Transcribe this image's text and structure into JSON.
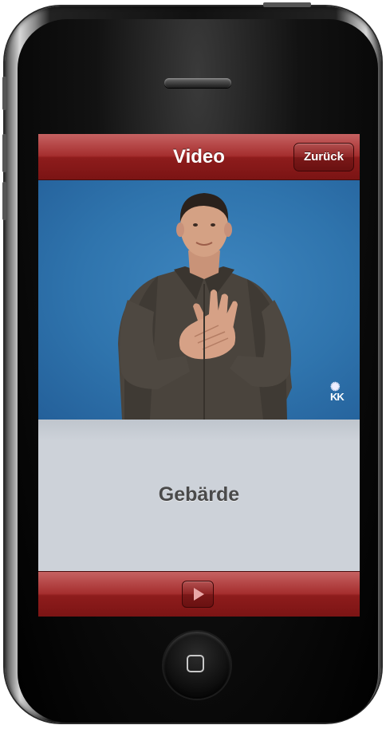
{
  "nav": {
    "title": "Video",
    "back_label": "Zurück"
  },
  "video": {
    "watermark": "KK",
    "watermark_glyph": "✺"
  },
  "content": {
    "sign_word": "Gebärde"
  },
  "toolbar": {
    "play_icon": "play-icon"
  },
  "colors": {
    "bar_red": "#8e1c1c",
    "video_blue": "#2f74ad",
    "panel_gray": "#cdd2d9",
    "label_text": "#4a4a4a"
  }
}
